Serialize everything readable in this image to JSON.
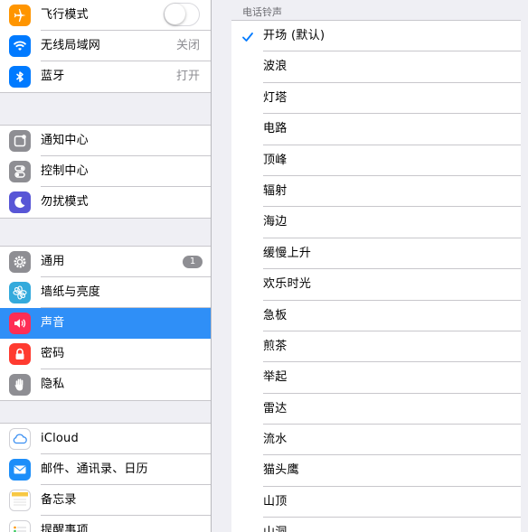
{
  "settings": {
    "groups": [
      {
        "items": [
          {
            "id": "airplane",
            "label": "飞行模式",
            "icon": "airplane-icon",
            "color": "#ff9500",
            "control": "toggle",
            "toggle_on": false
          },
          {
            "id": "wifi",
            "label": "无线局域网",
            "icon": "wifi-icon",
            "color": "#007aff",
            "value": "关闭"
          },
          {
            "id": "bluetooth",
            "label": "蓝牙",
            "icon": "bluetooth-icon",
            "color": "#007aff",
            "value": "打开"
          }
        ]
      },
      {
        "items": [
          {
            "id": "notifications",
            "label": "通知中心",
            "icon": "notification-center-icon",
            "color": "#8e8e93"
          },
          {
            "id": "control-center",
            "label": "控制中心",
            "icon": "control-center-icon",
            "color": "#8e8e93"
          },
          {
            "id": "do-not-disturb",
            "label": "勿扰模式",
            "icon": "moon-icon",
            "color": "#5856d6"
          }
        ]
      },
      {
        "items": [
          {
            "id": "general",
            "label": "通用",
            "icon": "gear-icon",
            "color": "#8e8e93",
            "badge": "1"
          },
          {
            "id": "wallpaper",
            "label": "墙纸与亮度",
            "icon": "flower-icon",
            "color": "#34aadc"
          },
          {
            "id": "sounds",
            "label": "声音",
            "icon": "speaker-icon",
            "color": "#ff2d55",
            "selected": true
          },
          {
            "id": "passcode",
            "label": "密码",
            "icon": "lock-icon",
            "color": "#ff3b30"
          },
          {
            "id": "privacy",
            "label": "隐私",
            "icon": "hand-icon",
            "color": "#8e8e93"
          }
        ]
      },
      {
        "items": [
          {
            "id": "icloud",
            "label": "iCloud",
            "icon": "cloud-icon",
            "color": "#ffffff"
          },
          {
            "id": "mail",
            "label": "邮件、通讯录、日历",
            "icon": "mail-icon",
            "color": "#1d8ef9"
          },
          {
            "id": "notes",
            "label": "备忘录",
            "icon": "notes-icon",
            "color": "#ffffff"
          },
          {
            "id": "reminders",
            "label": "提醒事项",
            "icon": "reminders-icon",
            "color": "#ffffff"
          }
        ]
      }
    ]
  },
  "ringtones": {
    "section_header": "电话铃声",
    "selected_index": 0,
    "items": [
      "开场 (默认)",
      "波浪",
      "灯塔",
      "电路",
      "顶峰",
      "辐射",
      "海边",
      "缓慢上升",
      "欢乐时光",
      "急板",
      "煎茶",
      "举起",
      "雷达",
      "流水",
      "猫头鹰",
      "山顶",
      "山洞"
    ]
  },
  "colors": {
    "accent": "#2f8ff7",
    "check": "#007aff"
  }
}
